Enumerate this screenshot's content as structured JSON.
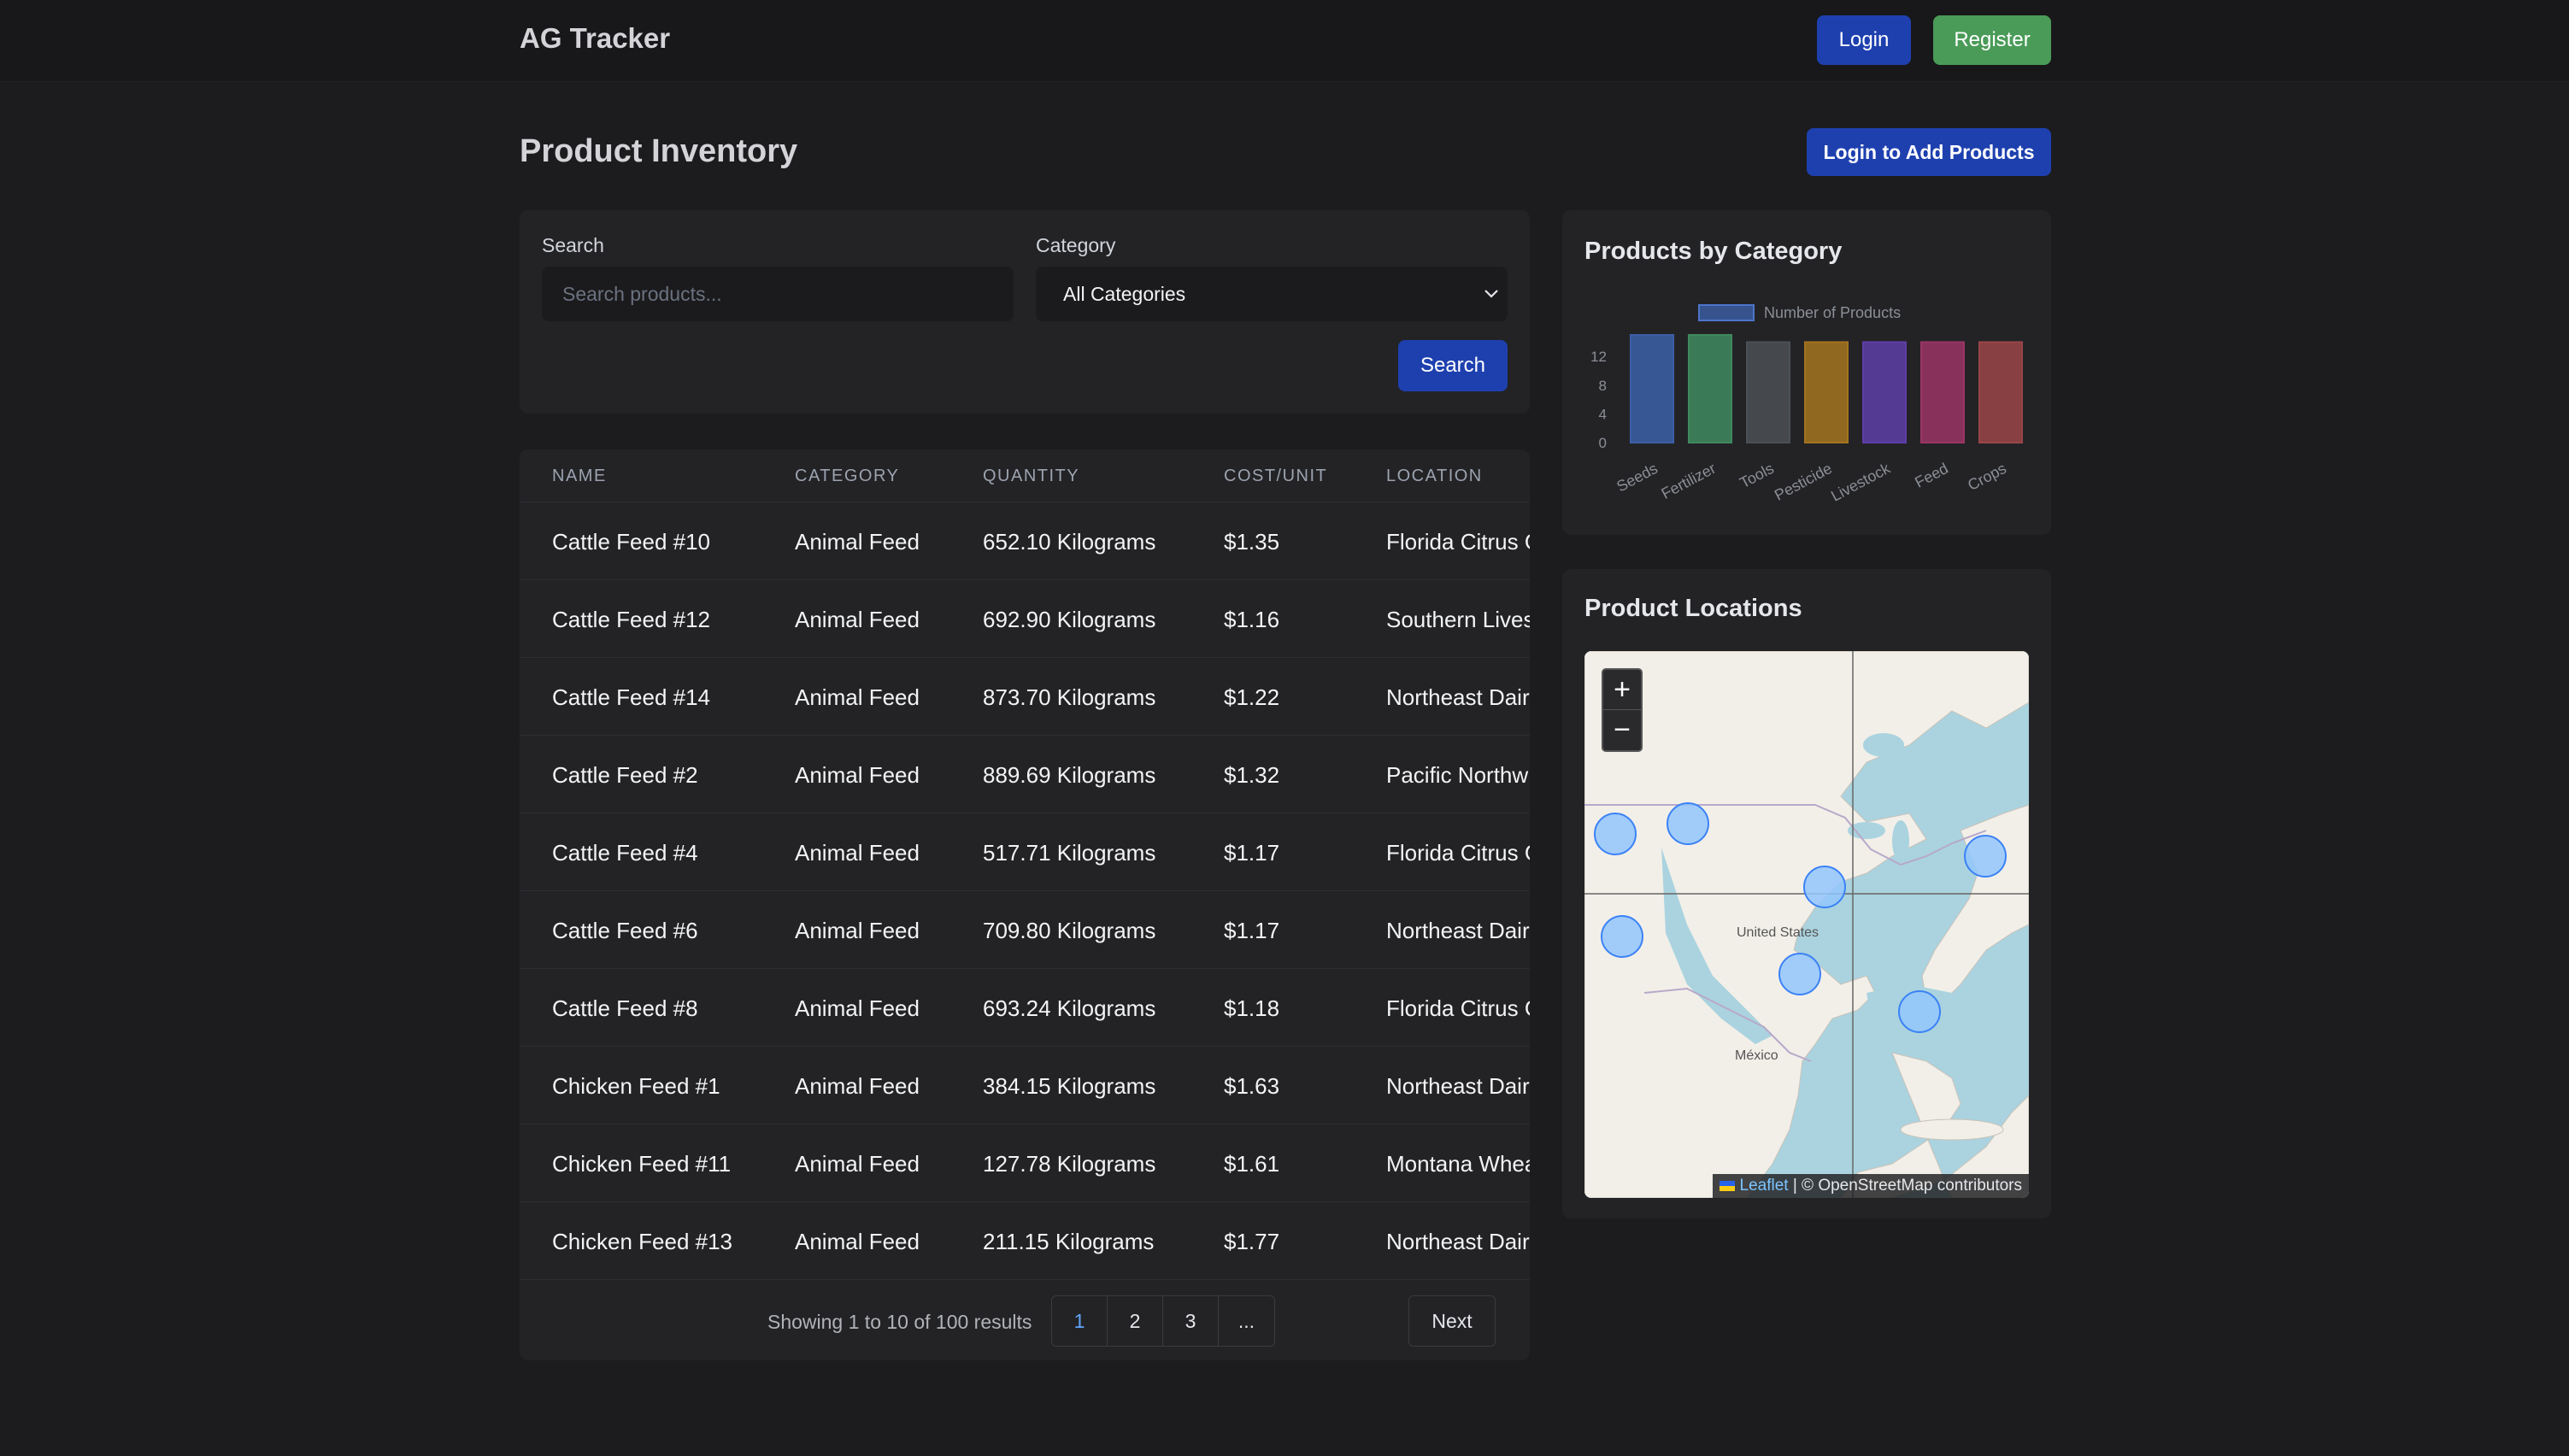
{
  "header": {
    "brand": "AG Tracker",
    "login_label": "Login",
    "register_label": "Register"
  },
  "page": {
    "title": "Product Inventory",
    "add_products_label": "Login to Add Products"
  },
  "filters": {
    "search_label": "Search",
    "search_placeholder": "Search products...",
    "search_value": "",
    "category_label": "Category",
    "category_selected": "All Categories",
    "search_button": "Search"
  },
  "table": {
    "columns": [
      "NAME",
      "CATEGORY",
      "QUANTITY",
      "COST/UNIT",
      "LOCATION"
    ],
    "rows": [
      [
        "Cattle Feed #10",
        "Animal Feed",
        "652.10 Kilograms",
        "$1.35",
        "Florida Citrus G"
      ],
      [
        "Cattle Feed #12",
        "Animal Feed",
        "692.90 Kilograms",
        "$1.16",
        "Southern Lives"
      ],
      [
        "Cattle Feed #14",
        "Animal Feed",
        "873.70 Kilograms",
        "$1.22",
        "Northeast Dair"
      ],
      [
        "Cattle Feed #2",
        "Animal Feed",
        "889.69 Kilograms",
        "$1.32",
        "Pacific Northw"
      ],
      [
        "Cattle Feed #4",
        "Animal Feed",
        "517.71 Kilograms",
        "$1.17",
        "Florida Citrus G"
      ],
      [
        "Cattle Feed #6",
        "Animal Feed",
        "709.80 Kilograms",
        "$1.17",
        "Northeast Dair"
      ],
      [
        "Cattle Feed #8",
        "Animal Feed",
        "693.24 Kilograms",
        "$1.18",
        "Florida Citrus G"
      ],
      [
        "Chicken Feed #1",
        "Animal Feed",
        "384.15 Kilograms",
        "$1.63",
        "Northeast Dair"
      ],
      [
        "Chicken Feed #11",
        "Animal Feed",
        "127.78 Kilograms",
        "$1.61",
        "Montana Whea"
      ],
      [
        "Chicken Feed #13",
        "Animal Feed",
        "211.15 Kilograms",
        "$1.77",
        "Northeast Dair"
      ]
    ]
  },
  "pagination": {
    "summary": "Showing 1 to 10 of 100 results",
    "pages": [
      "1",
      "2",
      "3",
      "..."
    ],
    "next_label": "Next"
  },
  "chart_panel": {
    "title": "Products by Category"
  },
  "chart_data": {
    "type": "bar",
    "legend": "Number of Products",
    "legend_position": "top",
    "categories": [
      "Seeds",
      "Fertilizer",
      "Tools",
      "Pesticide",
      "Livestock",
      "Feed",
      "Crops"
    ],
    "series": [
      {
        "name": "Number of Products",
        "values": [
          15,
          15,
          14,
          14,
          14,
          14,
          14
        ]
      }
    ],
    "colors": [
      "#3b5fa8",
      "#3f8a5f",
      "#4b5056",
      "#a4741f",
      "#5e3ea8",
      "#9a3565",
      "#9a4548"
    ],
    "yticks": [
      0,
      4,
      8,
      12
    ],
    "ylim": [
      0,
      15
    ],
    "grid": false
  },
  "map_panel": {
    "title": "Product Locations",
    "zoom_in": "+",
    "zoom_out": "−",
    "label_us": "United States",
    "label_mexico": "México",
    "attribution_leaflet": "Leaflet",
    "attribution_rest": " | © OpenStreetMap contributors"
  }
}
